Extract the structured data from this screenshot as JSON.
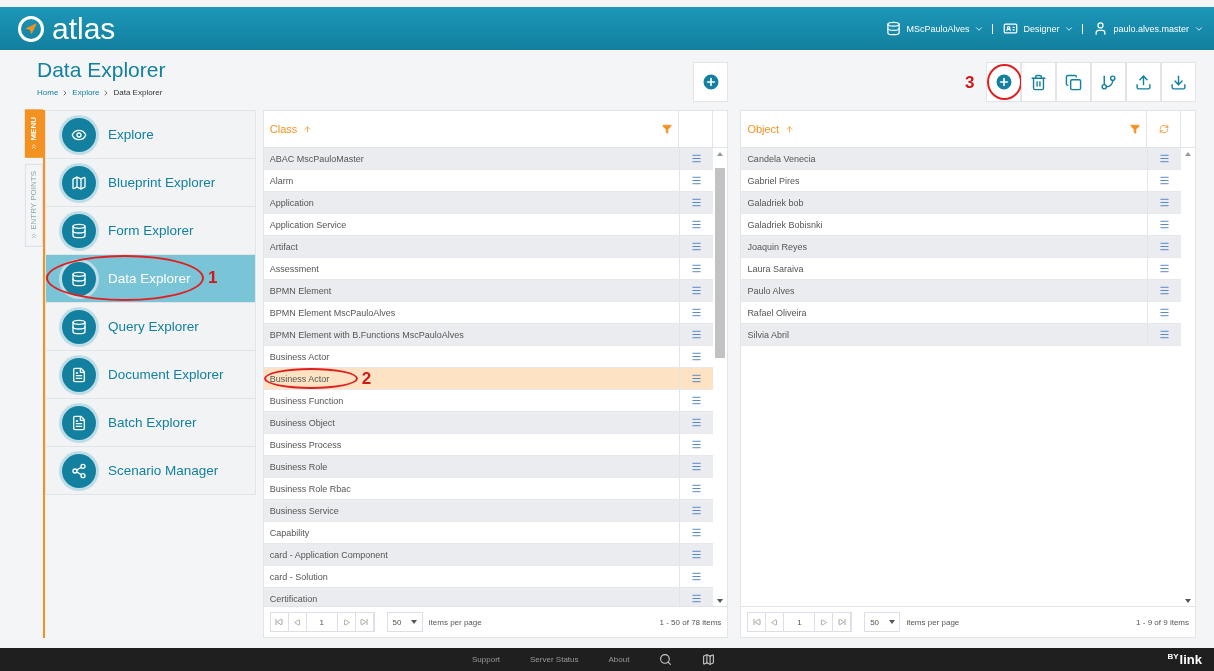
{
  "header": {
    "logo": "atlas",
    "menus": [
      {
        "label": "MScPauloAlves"
      },
      {
        "label": "Designer"
      },
      {
        "label": "paulo.alves.master"
      }
    ]
  },
  "page": {
    "title": "Data Explorer",
    "breadcrumb": [
      "Home",
      "Explore",
      "Data Explorer"
    ]
  },
  "side_tabs": [
    {
      "label": "MENU",
      "selected": true
    },
    {
      "label": "ENTRY POINTS",
      "selected": false
    }
  ],
  "sidebar": {
    "items": [
      {
        "label": "Explore",
        "selected": false
      },
      {
        "label": "Blueprint Explorer",
        "selected": false
      },
      {
        "label": "Form Explorer",
        "selected": false
      },
      {
        "label": "Data Explorer",
        "selected": true,
        "annotation": "1"
      },
      {
        "label": "Query Explorer",
        "selected": false
      },
      {
        "label": "Document Explorer",
        "selected": false
      },
      {
        "label": "Batch Explorer",
        "selected": false
      },
      {
        "label": "Scenario Manager",
        "selected": false
      }
    ]
  },
  "class_panel": {
    "header": "Class",
    "rows": [
      {
        "label": "ABAC MscPauloMaster",
        "selected": false
      },
      {
        "label": "Alarm",
        "selected": false
      },
      {
        "label": "Application",
        "selected": false
      },
      {
        "label": "Application Service",
        "selected": false
      },
      {
        "label": "Artifact",
        "selected": false
      },
      {
        "label": "Assessment",
        "selected": false
      },
      {
        "label": "BPMN Element",
        "selected": false
      },
      {
        "label": "BPMN Element MscPauloAlves",
        "selected": false
      },
      {
        "label": "BPMN Element with B.Functions MscPauloAlves",
        "selected": false
      },
      {
        "label": "Business Actor",
        "selected": false
      },
      {
        "label": "Business Actor",
        "selected": true,
        "annotation": "2"
      },
      {
        "label": "Business Function",
        "selected": false
      },
      {
        "label": "Business Object",
        "selected": false
      },
      {
        "label": "Business Process",
        "selected": false
      },
      {
        "label": "Business Role",
        "selected": false
      },
      {
        "label": "Business Role Rbac",
        "selected": false
      },
      {
        "label": "Business Service",
        "selected": false
      },
      {
        "label": "Capability",
        "selected": false
      },
      {
        "label": "card - Application Component",
        "selected": false
      },
      {
        "label": "card - Solution",
        "selected": false
      },
      {
        "label": "Certification",
        "selected": false
      }
    ],
    "pager": {
      "page": "1",
      "page_size": "50",
      "per_page_label": "items per page",
      "summary": "1 - 50 of 78 items"
    }
  },
  "object_panel": {
    "header": "Object",
    "rows": [
      {
        "label": "Candela Venecia",
        "selected": false
      },
      {
        "label": "Gabriel Pires",
        "selected": false
      },
      {
        "label": "Galadriek bob",
        "selected": false
      },
      {
        "label": "Galadriek Bobisnki",
        "selected": false
      },
      {
        "label": "Joaquin Reyes",
        "selected": false
      },
      {
        "label": "Laura Saraiva",
        "selected": false
      },
      {
        "label": "Paulo Alves",
        "selected": false
      },
      {
        "label": "Rafael Oliveira",
        "selected": false
      },
      {
        "label": "Silvia Abril",
        "selected": false
      }
    ],
    "pager": {
      "page": "1",
      "page_size": "50",
      "per_page_label": "items per page",
      "summary": "1 - 9 of 9 items"
    }
  },
  "toolbar_annotation": "3",
  "footer": {
    "links": [
      "Support",
      "Server Status",
      "About"
    ],
    "brand_prefix": "BY",
    "brand": "link"
  }
}
